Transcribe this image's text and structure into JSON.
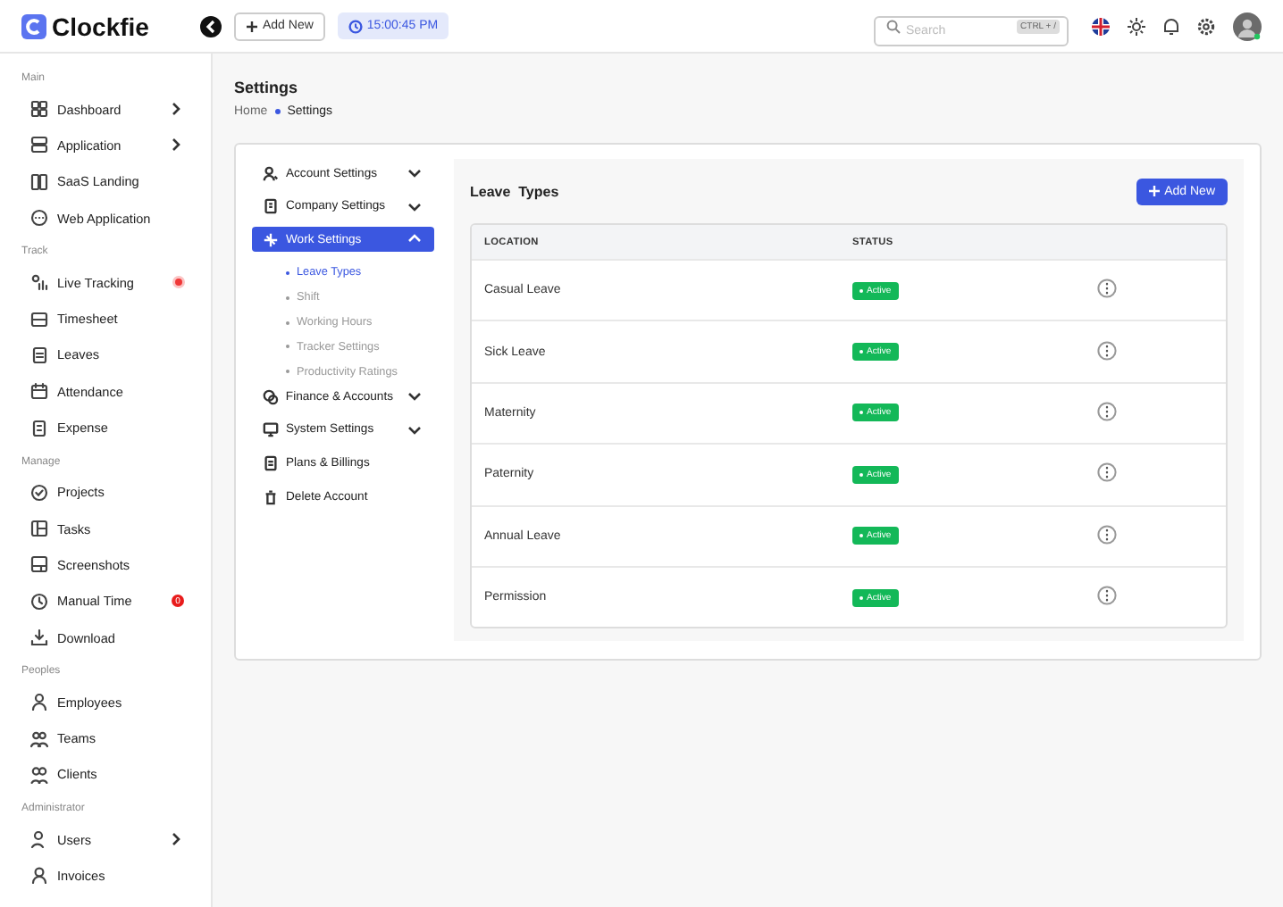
{
  "brand": {
    "name": "Clockfie"
  },
  "header": {
    "add_button": "Add New",
    "clock": "15:00:45 PM",
    "search": {
      "placeholder": "Search",
      "shortcut": "CTRL + /"
    }
  },
  "sidebar": {
    "sections": [
      {
        "title": "Main",
        "items": [
          {
            "label": "Dashboard",
            "kind": "submenu"
          },
          {
            "label": "Application",
            "kind": "submenu"
          },
          {
            "label": "SaaS Landing",
            "kind": "link"
          },
          {
            "label": "Web Application",
            "kind": "link"
          }
        ]
      },
      {
        "title": "Track",
        "items": [
          {
            "label": "Live Tracking",
            "kind": "alert"
          },
          {
            "label": "Timesheet",
            "kind": "link"
          },
          {
            "label": "Leaves",
            "kind": "link"
          },
          {
            "label": "Attendance",
            "kind": "link"
          },
          {
            "label": "Expense",
            "kind": "link"
          }
        ]
      },
      {
        "title": "Manage",
        "items": [
          {
            "label": "Projects",
            "kind": "link"
          },
          {
            "label": "Tasks",
            "kind": "link"
          },
          {
            "label": "Screenshots",
            "kind": "link"
          },
          {
            "label": "Manual Time",
            "kind": "counter",
            "badge": "0"
          },
          {
            "label": "Download",
            "kind": "link"
          }
        ]
      },
      {
        "title": "Peoples",
        "items": [
          {
            "label": "Employees",
            "kind": "link"
          },
          {
            "label": "Teams",
            "kind": "link"
          },
          {
            "label": "Clients",
            "kind": "link"
          }
        ]
      },
      {
        "title": "Administrator",
        "items": [
          {
            "label": "Users",
            "kind": "submenu"
          },
          {
            "label": "Invoices",
            "kind": "link"
          }
        ]
      }
    ]
  },
  "page": {
    "title": "Settings",
    "breadcrumb": [
      "Home",
      "Settings"
    ]
  },
  "settings_nav": [
    {
      "label": "Account Settings",
      "kind": "group",
      "selected": false,
      "expanded": false
    },
    {
      "label": "Company Settings",
      "kind": "group",
      "selected": false,
      "expanded": false
    },
    {
      "label": "Work Settings",
      "kind": "group",
      "selected": true,
      "expanded": true,
      "children": [
        {
          "label": "Leave Types",
          "selected": true
        },
        {
          "label": "Shift",
          "selected": false
        },
        {
          "label": "Working Hours",
          "selected": false
        },
        {
          "label": "Tracker Settings",
          "selected": false
        },
        {
          "label": "Productivity Ratings",
          "selected": false
        }
      ]
    },
    {
      "label": "Finance & Accounts",
      "kind": "group",
      "selected": false,
      "expanded": false
    },
    {
      "label": "System Settings",
      "kind": "group",
      "selected": false,
      "expanded": false
    },
    {
      "label": "Plans & Billings",
      "kind": "link",
      "selected": false
    },
    {
      "label": "Delete Account",
      "kind": "link",
      "selected": false
    }
  ],
  "panel": {
    "title": "Leave  Types",
    "add_button": "Add New"
  },
  "table": {
    "columns": [
      "LOCATION",
      "STATUS"
    ],
    "rows": [
      {
        "location": "Casual Leave",
        "status": "Active"
      },
      {
        "location": "Sick Leave",
        "status": "Active"
      },
      {
        "location": "Maternity",
        "status": "Active"
      },
      {
        "location": "Paternity",
        "status": "Active"
      },
      {
        "location": "Annual Leave",
        "status": "Active"
      },
      {
        "location": "Permission",
        "status": "Active"
      }
    ]
  }
}
